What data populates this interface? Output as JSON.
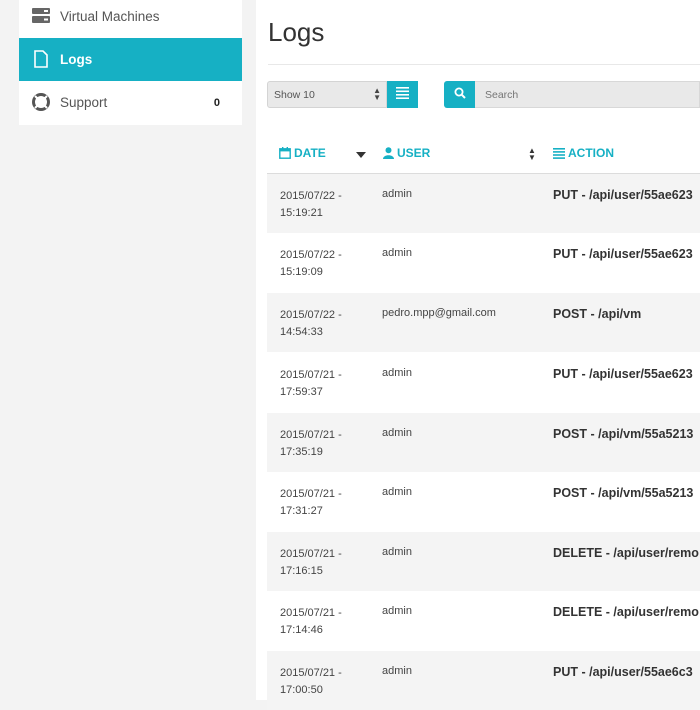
{
  "sidebar": {
    "items": [
      {
        "label": "Virtual Machines",
        "icon": "server-icon"
      },
      {
        "label": "Logs",
        "icon": "document-icon"
      },
      {
        "label": "Support",
        "icon": "lifebuoy-icon",
        "badge": "0"
      }
    ]
  },
  "page": {
    "title": "Logs"
  },
  "toolbar": {
    "show_select": "Show 10",
    "search_placeholder": "Search"
  },
  "table": {
    "headers": {
      "date": "DATE",
      "user": "USER",
      "action": "ACTION"
    },
    "rows": [
      {
        "date1": "2015/07/22 -",
        "date2": "15:19:21",
        "user": "admin",
        "action": "PUT - /api/user/55ae623"
      },
      {
        "date1": "2015/07/22 -",
        "date2": "15:19:09",
        "user": "admin",
        "action": "PUT - /api/user/55ae623"
      },
      {
        "date1": "2015/07/22 -",
        "date2": "14:54:33",
        "user": "pedro.mpp@gmail.com",
        "action": "POST - /api/vm"
      },
      {
        "date1": "2015/07/21 -",
        "date2": "17:59:37",
        "user": "admin",
        "action": "PUT - /api/user/55ae623"
      },
      {
        "date1": "2015/07/21 -",
        "date2": "17:35:19",
        "user": "admin",
        "action": "POST - /api/vm/55a5213"
      },
      {
        "date1": "2015/07/21 -",
        "date2": "17:31:27",
        "user": "admin",
        "action": "POST - /api/vm/55a5213"
      },
      {
        "date1": "2015/07/21 -",
        "date2": "17:16:15",
        "user": "admin",
        "action": "DELETE - /api/user/remo"
      },
      {
        "date1": "2015/07/21 -",
        "date2": "17:14:46",
        "user": "admin",
        "action": "DELETE - /api/user/remo"
      },
      {
        "date1": "2015/07/21 -",
        "date2": "17:00:50",
        "user": "admin",
        "action": "PUT - /api/user/55ae6c3"
      }
    ]
  },
  "colors": {
    "accent": "#16b0c4"
  }
}
